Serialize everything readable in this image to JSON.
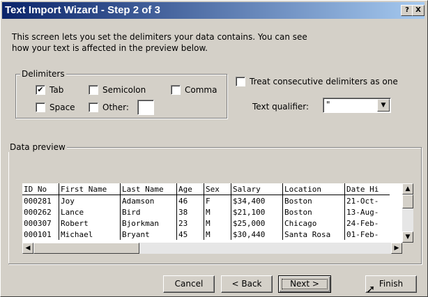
{
  "window": {
    "title": "Text Import Wizard - Step 2 of 3"
  },
  "intro": {
    "line1": "This screen lets you set the delimiters your data contains.  You can see",
    "line2": "how your text is affected in the preview below."
  },
  "delimiters": {
    "legend": "Delimiters",
    "tab": {
      "label": "Tab",
      "checked": true
    },
    "semicolon": {
      "label": "Semicolon",
      "checked": false
    },
    "comma": {
      "label": "Comma",
      "checked": false
    },
    "space": {
      "label": "Space",
      "checked": false
    },
    "other": {
      "label": "Other:",
      "checked": false,
      "value": ""
    }
  },
  "treat_consecutive": {
    "label": "Treat consecutive delimiters as one",
    "checked": false
  },
  "text_qualifier": {
    "label": "Text qualifier:",
    "value": "\""
  },
  "preview": {
    "legend": "Data preview",
    "headers": [
      "ID No",
      "First Name",
      "Last Name",
      "Age",
      "Sex",
      "Salary",
      "Location",
      "Date Hi"
    ],
    "rows": [
      [
        "000281",
        "Joy",
        "Adamson",
        "46",
        "F",
        "$34,400",
        "Boston",
        "21-Oct-"
      ],
      [
        "000262",
        "Lance",
        "Bird",
        "38",
        "M",
        "$21,100",
        "Boston",
        "13-Aug-"
      ],
      [
        "000307",
        "Robert",
        "Bjorkman",
        "23",
        "M",
        "$25,000",
        "Chicago",
        "24-Feb-"
      ],
      [
        "000101",
        "Michael",
        "Bryant",
        "45",
        "M",
        "$30,440",
        "Santa Rosa",
        "01-Feb-"
      ]
    ]
  },
  "buttons": {
    "cancel": "Cancel",
    "back": "< Back",
    "next": "Next >",
    "finish": "Finish"
  },
  "titlebar_buttons": {
    "help": "?",
    "close": "X"
  }
}
